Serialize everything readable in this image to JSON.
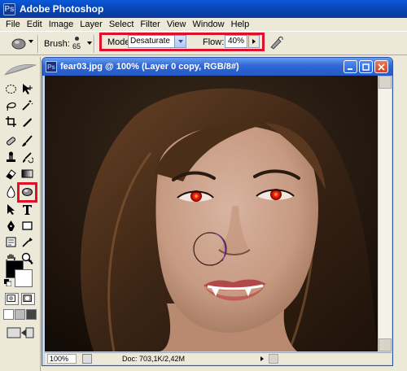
{
  "app": {
    "title": "Adobe Photoshop"
  },
  "menu": [
    "File",
    "Edit",
    "Image",
    "Layer",
    "Select",
    "Filter",
    "View",
    "Window",
    "Help"
  ],
  "options": {
    "brush_label": "Brush:",
    "brush_size": "65",
    "mode_label": "Mode:",
    "mode_value": "Desaturate",
    "flow_label": "Flow:",
    "flow_value": "40%"
  },
  "document": {
    "title": "fear03.jpg @ 100% (Layer 0 copy, RGB/8#)",
    "zoom": "100%",
    "doc_info": "Doc: 703,1K/2,42M"
  },
  "colors": {
    "highlight": "#e0102a",
    "foreground": "#000000",
    "background": "#ffffff"
  }
}
